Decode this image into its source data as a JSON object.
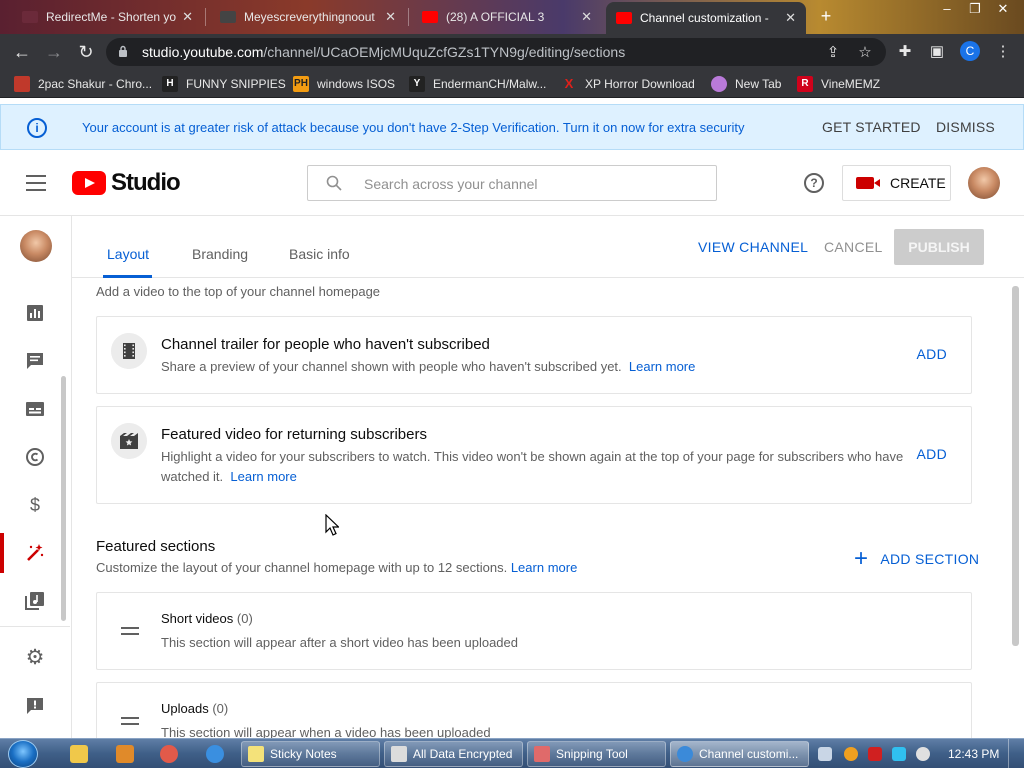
{
  "browser": {
    "tabs": [
      {
        "title": "RedirectMe - Shorten yo",
        "favicon_color": "#6b2a3a"
      },
      {
        "title": "Meyescreverythingnoout",
        "favicon_color": "#444444"
      },
      {
        "title": "(28) A OFFICIAL 3",
        "favicon_color": "#ff0000"
      },
      {
        "title": "Channel customization -",
        "favicon_color": "#ff0000"
      }
    ],
    "new_tab": "+",
    "url_host": "studio.youtube.com",
    "url_path": "/channel/UCaOEMjcMUquZcfGZs1TYN9g/editing/sections",
    "profile_initial": "C",
    "bookmarks": [
      {
        "label": "2pac Shakur - Chro...",
        "icon_color": "#c0392b",
        "icon_text": ""
      },
      {
        "label": "FUNNY SNIPPIES",
        "icon_color": "#222222",
        "icon_text": "H"
      },
      {
        "label": "windows ISOS",
        "icon_color": "#f39c12",
        "icon_text": "PH"
      },
      {
        "label": "EndermanCH/Malw...",
        "icon_color": "#222222",
        "icon_text": "Y"
      },
      {
        "label": "XP Horror Download",
        "icon_color": "#e0201a",
        "icon_text": "X"
      },
      {
        "label": "New Tab",
        "icon_color": "#b97ad9",
        "icon_text": ""
      },
      {
        "label": "VineMEMZ",
        "icon_color": "#d0021b",
        "icon_text": "R"
      }
    ]
  },
  "banner": {
    "message": "Your account is at greater risk of attack because you don't have 2-Step Verification. Turn it on now for extra security",
    "get_started": "GET STARTED",
    "dismiss": "DISMISS"
  },
  "header": {
    "logo_text": "Studio",
    "search_placeholder": "Search across your channel",
    "help": "?",
    "create_label": "CREATE"
  },
  "tabs": {
    "layout": "Layout",
    "branding": "Branding",
    "basic_info": "Basic info",
    "view_channel": "VIEW CHANNEL",
    "cancel": "CANCEL",
    "publish": "PUBLISH"
  },
  "spotlight": {
    "intro": "Add a video to the top of your channel homepage",
    "trailer_title": "Channel trailer for people who haven't subscribed",
    "trailer_desc": "Share a preview of your channel shown with people who haven't subscribed yet.",
    "featured_title": "Featured video for returning subscribers",
    "featured_desc": "Highlight a video for your subscribers to watch. This video won't be shown again at the top of your page for subscribers who have watched it.",
    "learn_more": "Learn more",
    "add": "ADD"
  },
  "featured_sections": {
    "title": "Featured sections",
    "desc": "Customize the layout of your channel homepage with up to 12 sections.",
    "learn_more": "Learn more",
    "add_section": "ADD SECTION",
    "sections": [
      {
        "name": "Short videos",
        "count": "(0)",
        "desc": "This section will appear after a short video has been uploaded"
      },
      {
        "name": "Uploads",
        "count": "(0)",
        "desc": "This section will appear when a video has been uploaded"
      }
    ]
  },
  "taskbar": {
    "windows": [
      {
        "label": "Sticky Notes",
        "icon_color": "#f4e27a"
      },
      {
        "label": "All Data Encrypted",
        "icon_color": "#dcdcdc"
      },
      {
        "label": "Snipping Tool",
        "icon_color": "#e06a6a"
      },
      {
        "label": "Channel customi...",
        "icon_color": "#3b8ad9"
      }
    ],
    "clock": "12:43 PM"
  }
}
